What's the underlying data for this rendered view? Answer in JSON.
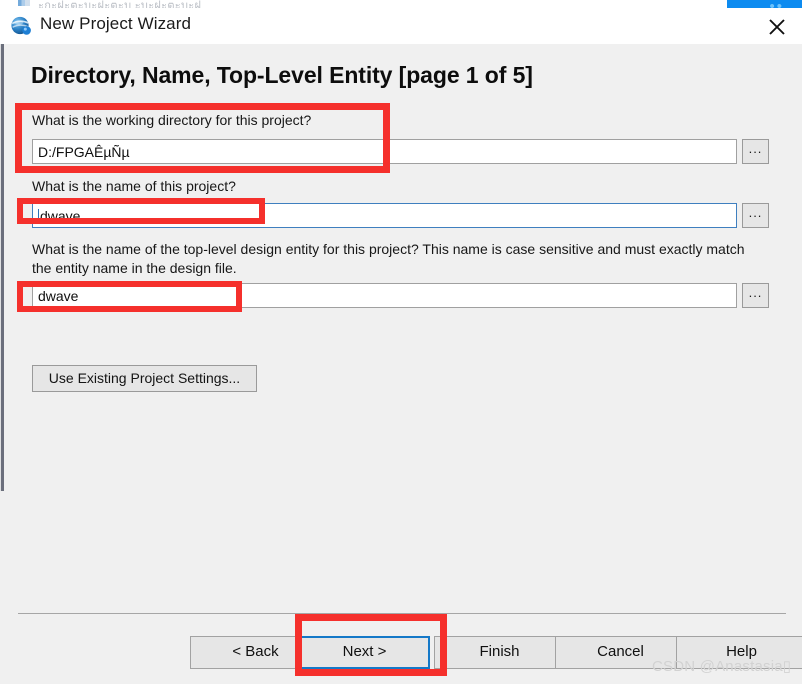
{
  "background": {
    "parent_window_title": "ะกะฝะตะบะฝะตะบ ะบะฝะตะบะฝ",
    "icon": "quartus-icon"
  },
  "titlebar": {
    "title": "New Project Wizard",
    "icon": "quartus-globe-icon",
    "close_icon": "close-icon"
  },
  "page": {
    "heading": "Directory, Name, Top-Level Entity [page 1 of 5]"
  },
  "fields": {
    "working_directory": {
      "label": "What is the working directory for this project?",
      "value": "D:/FPGAÊµÑµ",
      "browse_label": "...",
      "focused": false
    },
    "project_name": {
      "label": "What is the name of this project?",
      "value": "dwave",
      "browse_label": "...",
      "focused": true
    },
    "top_level_entity": {
      "label": "What is the name of the top-level design entity for this project? This name is case sensitive and must exactly match the entity name in the design file.",
      "value": "dwave",
      "browse_label": "...",
      "focused": false
    }
  },
  "actions": {
    "use_existing_settings": "Use Existing Project Settings...",
    "back": "< Back",
    "next": "Next >",
    "finish": "Finish",
    "cancel": "Cancel",
    "help": "Help"
  },
  "watermark": {
    "text": "CSDN @Anastasia▯",
    "sub": ""
  },
  "colors": {
    "accent_blue": "#1579c8",
    "annotation_red": "#f5302c",
    "dialog_bg": "#f0f0f0",
    "field_bg": "#ffffff",
    "chip_blue": "#0d8bf0"
  }
}
